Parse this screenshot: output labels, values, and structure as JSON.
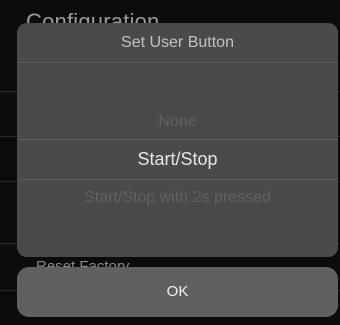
{
  "background_screen": {
    "title": "Configuration",
    "partial_item": "Reset Factory"
  },
  "dialog": {
    "title": "Set User Button",
    "options": [
      {
        "label": "None",
        "selected": false
      },
      {
        "label": "Start/Stop",
        "selected": true
      },
      {
        "label": "Start/Stop with 2s pressed",
        "selected": false
      }
    ]
  },
  "actions": {
    "ok_label": "OK"
  },
  "colors": {
    "background": "#0c0c0c",
    "dialog": "#4a4a4a",
    "button": "#606060",
    "selected_text": "#e6e6e6",
    "dim_text": "#616161"
  }
}
